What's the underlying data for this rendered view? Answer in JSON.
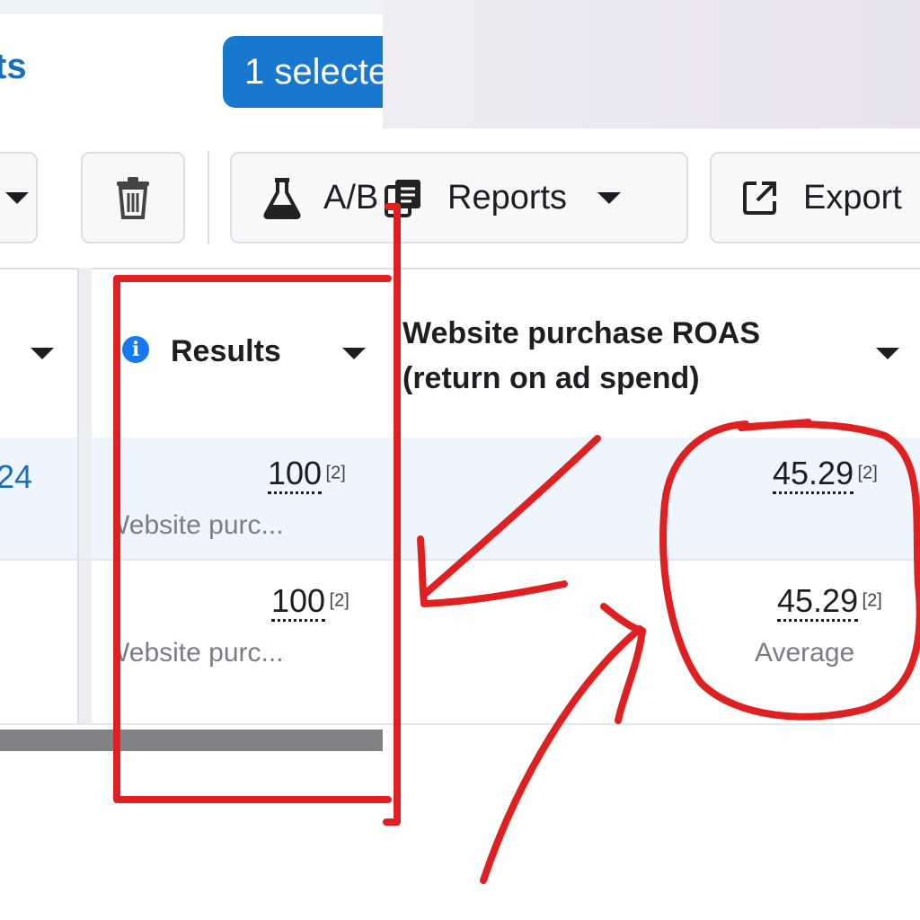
{
  "header": {
    "title_fragment": "ts",
    "selected_label": "1 selecte"
  },
  "toolbar": {
    "ab_label": "A/B",
    "reports_label": "Reports",
    "export_label": "Export"
  },
  "table": {
    "columns": [
      {
        "label": "Results"
      },
      {
        "label_line1": "Website purchase ROAS",
        "label_line2": "(return on ad spend)"
      }
    ],
    "rows": [
      {
        "left_value": "24",
        "results": "100",
        "results_ref": "[2]",
        "results_sub": "Website purc...",
        "roas": "45.29",
        "roas_ref": "[2]",
        "roas_sub": ""
      },
      {
        "left_value": "",
        "results": "100",
        "results_ref": "[2]",
        "results_sub": "Website purc...",
        "roas": "45.29",
        "roas_ref": "[2]",
        "roas_sub": "Average"
      }
    ]
  },
  "icons": {
    "trash": "trash-icon",
    "flask": "flask-icon",
    "reports": "reports-icon",
    "export": "export-icon",
    "info": "info-icon"
  },
  "colors": {
    "accent": "#1877cf",
    "annotation": "#e02020",
    "selected_row": "#eef5fe"
  }
}
